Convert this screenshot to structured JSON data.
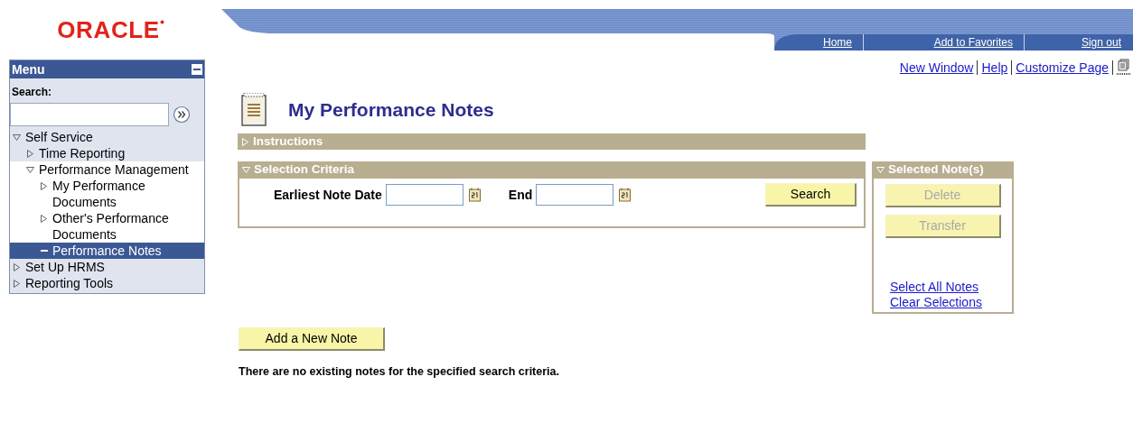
{
  "logo": {
    "text": "ORACLE"
  },
  "header_links": [
    "Home",
    "Add to Favorites",
    "Sign out"
  ],
  "menu": {
    "title": "Menu",
    "search_label": "Search:",
    "items": [
      {
        "label": "Self Service",
        "kind": "folder",
        "expanded": true,
        "selected": false,
        "children": [
          {
            "label": "Time Reporting",
            "kind": "folder",
            "expanded": false,
            "selected": false
          },
          {
            "label": "Performance Management",
            "kind": "folder",
            "expanded": true,
            "selected": false,
            "children": [
              {
                "label": "My Performance Documents",
                "kind": "folder",
                "expanded": false,
                "selected": false
              },
              {
                "label": "Other's Performance Documents",
                "kind": "folder",
                "expanded": false,
                "selected": false
              },
              {
                "label": "Performance Notes",
                "kind": "page",
                "selected": true
              }
            ]
          }
        ]
      },
      {
        "label": "Set Up HRMS",
        "kind": "folder",
        "expanded": false,
        "selected": false
      },
      {
        "label": "Reporting Tools",
        "kind": "folder",
        "expanded": false,
        "selected": false
      }
    ]
  },
  "page_links": [
    "New Window",
    "Help",
    "Customize Page"
  ],
  "page_title": "My Performance Notes",
  "instructions": {
    "title": "Instructions",
    "expanded": false
  },
  "selection_criteria": {
    "title": "Selection Criteria",
    "expanded": true,
    "fields": [
      {
        "label": "Earliest Note Date"
      },
      {
        "label": "End"
      }
    ],
    "search_button": {
      "label": "Search",
      "disabled": false
    }
  },
  "selected_notes": {
    "title": "Selected Note(s)",
    "expanded": true,
    "buttons": [
      {
        "label": "Delete",
        "disabled": true
      },
      {
        "label": "Transfer",
        "disabled": true
      }
    ],
    "links": [
      "Select All Notes",
      "Clear Selections"
    ]
  },
  "add_button": {
    "label": "Add a New Note",
    "disabled": false
  },
  "message": "There are no existing notes for the specified search criteria."
}
